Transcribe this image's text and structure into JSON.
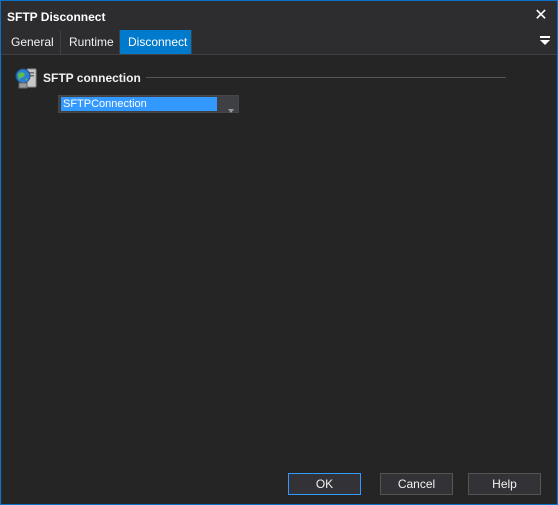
{
  "window": {
    "title": "SFTP Disconnect"
  },
  "tabs": [
    {
      "label": "General"
    },
    {
      "label": "Runtime"
    },
    {
      "label": "Disconnect",
      "active": true
    }
  ],
  "group": {
    "title": "SFTP connection"
  },
  "connection_select": {
    "value": "SFTPConnection"
  },
  "buttons": {
    "ok": "OK",
    "cancel": "Cancel",
    "help": "Help"
  },
  "colors": {
    "accent": "#007acc",
    "selection": "#3399ff",
    "background": "#2d2d30"
  },
  "icons": {
    "close": "close-icon",
    "tab_menu": "dropdown-menu-icon",
    "group": "globe-server-icon"
  }
}
